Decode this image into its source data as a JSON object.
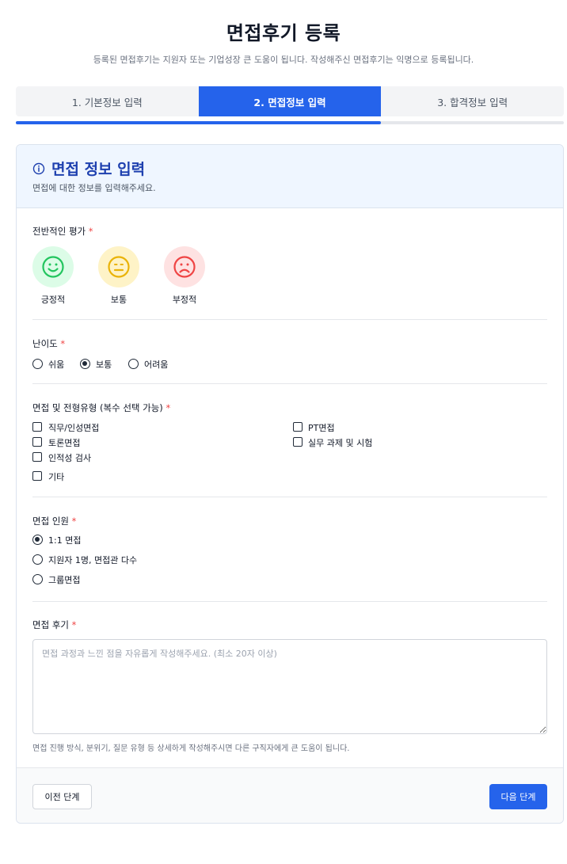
{
  "header": {
    "title": "면접후기 등록",
    "subtitle": "등록된 면접후기는 지원자 또는 기업성장 큰 도움이 됩니다. 작성해주신 면접후기는 익명으로 등록됩니다."
  },
  "steps": [
    {
      "label": "1. 기본정보 입력",
      "active": false
    },
    {
      "label": "2. 면접정보 입력",
      "active": true
    },
    {
      "label": "3. 합격정보 입력",
      "active": false
    }
  ],
  "progress": {
    "current_step": 2,
    "total_steps": 3
  },
  "card": {
    "title": "면접 정보 입력",
    "title_icon": "info-circle-icon",
    "description": "면접에 대한 정보를 입력해주세요."
  },
  "required_mark": "*",
  "evaluation": {
    "label": "전반적인 평가",
    "options": [
      {
        "label": "긍정적",
        "icon": "smile-face-icon",
        "color": "#22c55e",
        "bg": "#dcfce7"
      },
      {
        "label": "보통",
        "icon": "neutral-face-icon",
        "color": "#eab308",
        "bg": "#fef3c7"
      },
      {
        "label": "부정적",
        "icon": "sad-face-icon",
        "color": "#ef4444",
        "bg": "#fee2e2"
      }
    ]
  },
  "difficulty": {
    "label": "난이도",
    "options": [
      "쉬움",
      "보통",
      "어려움"
    ],
    "selected": "보통"
  },
  "interview_types": {
    "label": "면접 및 전형유형 (복수 선택 가능)",
    "options": [
      "직무/인성면접",
      "토론면접",
      "인적성 검사",
      "기타",
      "PT면접",
      "실무 과제 및 시험"
    ],
    "checked": []
  },
  "interview_people": {
    "label": "면접 인원",
    "options": [
      "1:1 면접",
      "지원자 1명, 면접관 다수",
      "그룹면접"
    ],
    "selected": "1:1 면접"
  },
  "review": {
    "label": "면접 후기",
    "placeholder": "면접 과정과 느낀 점을 자유롭게 작성해주세요. (최소 20자 이상)",
    "value": "",
    "hint": "면접 진행 방식, 분위기, 질문 유형 등 상세하게 작성해주시면 다른 구직자에게 큰 도움이 됩니다."
  },
  "footer": {
    "prev_label": "이전 단계",
    "next_label": "다음 단계"
  },
  "colors": {
    "primary": "#2563eb",
    "title_blue": "#1e40af",
    "required": "#ef4444"
  }
}
